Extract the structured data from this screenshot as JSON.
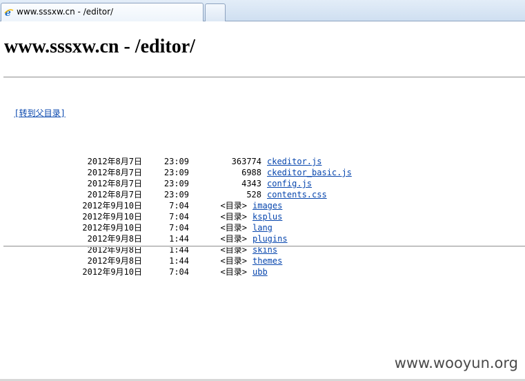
{
  "browser": {
    "tab_title": "www.sssxw.cn - /editor/",
    "tab_icon": "ie-logo-icon",
    "new_tab_icon": "new-tab-icon"
  },
  "page": {
    "title": "www.sssxw.cn - /editor/",
    "parent_link": "[转到父目录]"
  },
  "listing": {
    "dir_marker": "<目录>",
    "entries": [
      {
        "date": "2012年8月7日",
        "time": "23:09",
        "size": "363774",
        "name": "ckeditor.js",
        "is_dir": false
      },
      {
        "date": "2012年8月7日",
        "time": "23:09",
        "size": "6988",
        "name": "ckeditor_basic.js",
        "is_dir": false
      },
      {
        "date": "2012年8月7日",
        "time": "23:09",
        "size": "4343",
        "name": "config.js",
        "is_dir": false
      },
      {
        "date": "2012年8月7日",
        "time": "23:09",
        "size": "528",
        "name": "contents.css",
        "is_dir": false
      },
      {
        "date": "2012年9月10日",
        "time": "7:04",
        "size": "<目录>",
        "name": "images",
        "is_dir": true
      },
      {
        "date": "2012年9月10日",
        "time": "7:04",
        "size": "<目录>",
        "name": "ksplus",
        "is_dir": true
      },
      {
        "date": "2012年9月10日",
        "time": "7:04",
        "size": "<目录>",
        "name": "lang",
        "is_dir": true
      },
      {
        "date": "2012年9月8日",
        "time": "1:44",
        "size": "<目录>",
        "name": "plugins",
        "is_dir": true
      },
      {
        "date": "2012年9月8日",
        "time": "1:44",
        "size": "<目录>",
        "name": "skins",
        "is_dir": true
      },
      {
        "date": "2012年9月8日",
        "time": "1:44",
        "size": "<目录>",
        "name": "themes",
        "is_dir": true
      },
      {
        "date": "2012年9月10日",
        "time": "7:04",
        "size": "<目录>",
        "name": "ubb",
        "is_dir": true
      }
    ]
  },
  "watermark": "www.wooyun.org",
  "colors": {
    "link": "#0645ad",
    "tabbar": "#dbe6f4"
  }
}
